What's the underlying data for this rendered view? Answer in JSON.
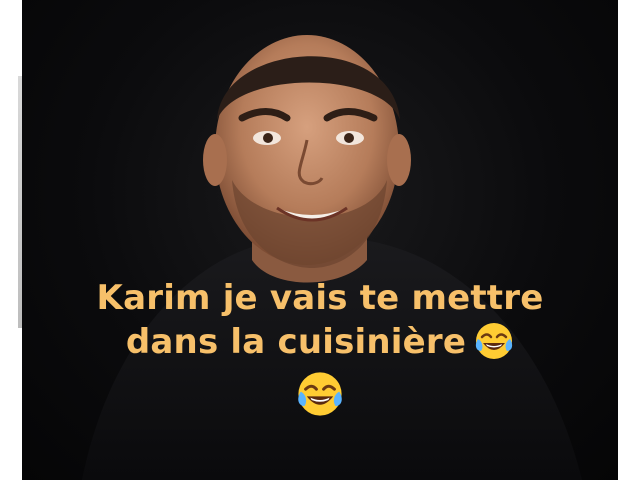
{
  "caption": {
    "line1": "Karim je vais te mettre",
    "line2": "dans la cuisinière",
    "emoji": "face-with-tears-of-joy"
  },
  "colors": {
    "caption_text": "#f7c06a",
    "background": "#0b0b0d"
  }
}
